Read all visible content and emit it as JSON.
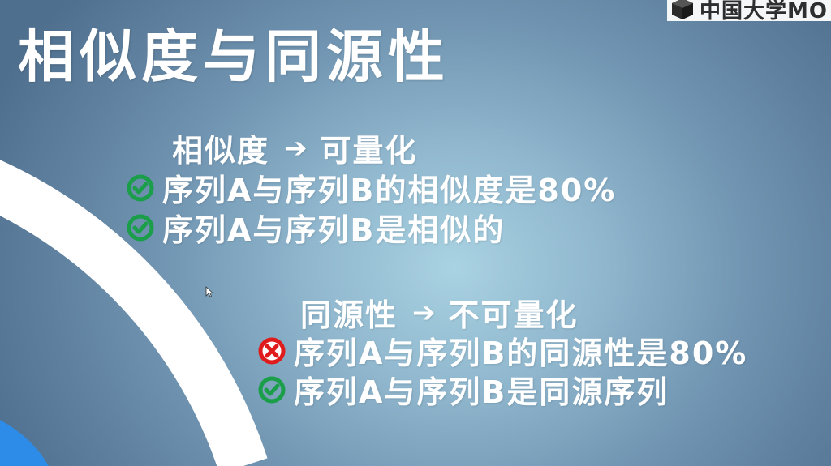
{
  "watermark": {
    "text": "中国大学MO"
  },
  "title": "相似度与同源性",
  "section_similarity": {
    "head_left": "相似度",
    "arrow": "➔",
    "head_right": "可量化",
    "items": [
      {
        "status": "correct",
        "text": "序列A与序列B的相似度是80%"
      },
      {
        "status": "correct",
        "text": "序列A与序列B是相似的"
      }
    ]
  },
  "section_homology": {
    "head_left": "同源性",
    "arrow": "➔",
    "head_right": "不可量化",
    "items": [
      {
        "status": "wrong",
        "text": "序列A与序列B的同源性是80%"
      },
      {
        "status": "correct",
        "text": "序列A与序列B是同源序列"
      }
    ]
  },
  "colors": {
    "check": "#1a9e4a",
    "cross": "#e01b1b",
    "arc": "#ffffff",
    "corner": "#2c8ce8"
  },
  "icons": {
    "correct": "check-circle-icon",
    "wrong": "x-circle-icon"
  }
}
